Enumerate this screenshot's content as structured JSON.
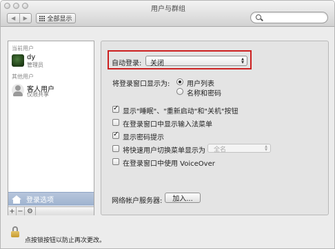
{
  "window": {
    "title": "用户与群组"
  },
  "toolbar": {
    "back_glyph": "◀",
    "forward_glyph": "▶",
    "show_all_label": "全部显示",
    "search_placeholder": ""
  },
  "sidebar": {
    "current_user_heading": "当前用户",
    "current_user": {
      "name": "dy",
      "role": "管理员"
    },
    "other_users_heading": "其他用户",
    "other_users": [
      {
        "name": "客人用户",
        "role": "仅限共享"
      }
    ],
    "login_options_label": "登录选项",
    "add_glyph": "+",
    "remove_glyph": "−",
    "gear_glyph": "⚙"
  },
  "panel": {
    "auto_login_label": "自动登录:",
    "auto_login_value": "关闭",
    "display_as_label": "将登录窗口显示为:",
    "display_options": [
      {
        "label": "用户列表",
        "selected": true
      },
      {
        "label": "名称和密码",
        "selected": false
      }
    ],
    "checkboxes": [
      {
        "label": "显示\"睡眠\"、\"重新启动\"和\"关机\"按钮",
        "checked": true
      },
      {
        "label": "在登录窗口中显示输入法菜单",
        "checked": false
      },
      {
        "label": "显示密码提示",
        "checked": true
      },
      {
        "label": "将快速用户切换菜单显示为",
        "checked": false
      },
      {
        "label": "在登录窗口中使用 VoiceOver",
        "checked": false
      }
    ],
    "fast_switch_value": "全名",
    "network_server_label": "网络帐户服务器:",
    "join_button_label": "加入..."
  },
  "footer": {
    "lock_text": "点按锁按钮以防止再次更改。"
  },
  "colors": {
    "highlight_border": "#cc1f1f",
    "selected_row": "#9eb2cf"
  }
}
